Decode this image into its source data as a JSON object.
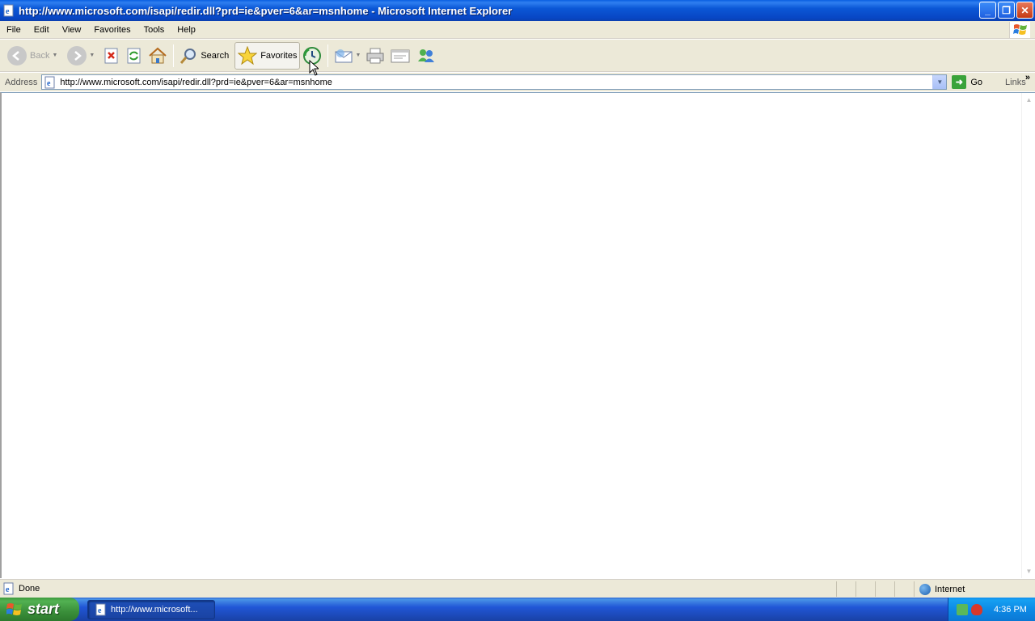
{
  "window": {
    "title": "http://www.microsoft.com/isapi/redir.dll?prd=ie&pver=6&ar=msnhome - Microsoft Internet Explorer",
    "buttons": [
      "minimize",
      "restore",
      "close"
    ]
  },
  "menubar": {
    "items": [
      "File",
      "Edit",
      "View",
      "Favorites",
      "Tools",
      "Help"
    ]
  },
  "toolbar": {
    "back_label": "Back",
    "search_label": "Search",
    "favorites_label": "Favorites"
  },
  "addressbar": {
    "label": "Address",
    "url": "http://www.microsoft.com/isapi/redir.dll?prd=ie&pver=6&ar=msnhome",
    "go_label": "Go",
    "links_label": "Links"
  },
  "statusbar": {
    "status_text": "Done",
    "zone_label": "Internet"
  },
  "taskbar": {
    "start_label": "start",
    "task_item_label": "http://www.microsoft...",
    "clock": "4:36 PM"
  },
  "colors": {
    "titlebar_blue": "#0a5fe0",
    "chrome_beige": "#ece9d8",
    "start_green": "#3c9a3c",
    "taskbar_blue": "#2157d7"
  },
  "icons": [
    "ie-page-icon",
    "back-icon",
    "forward-icon",
    "stop-icon",
    "refresh-icon",
    "home-icon",
    "search-icon",
    "favorites-star-icon",
    "history-icon",
    "mail-icon",
    "print-icon",
    "edit-icon",
    "messenger-icon",
    "go-arrow-icon",
    "globe-icon",
    "windows-flag-icon"
  ]
}
